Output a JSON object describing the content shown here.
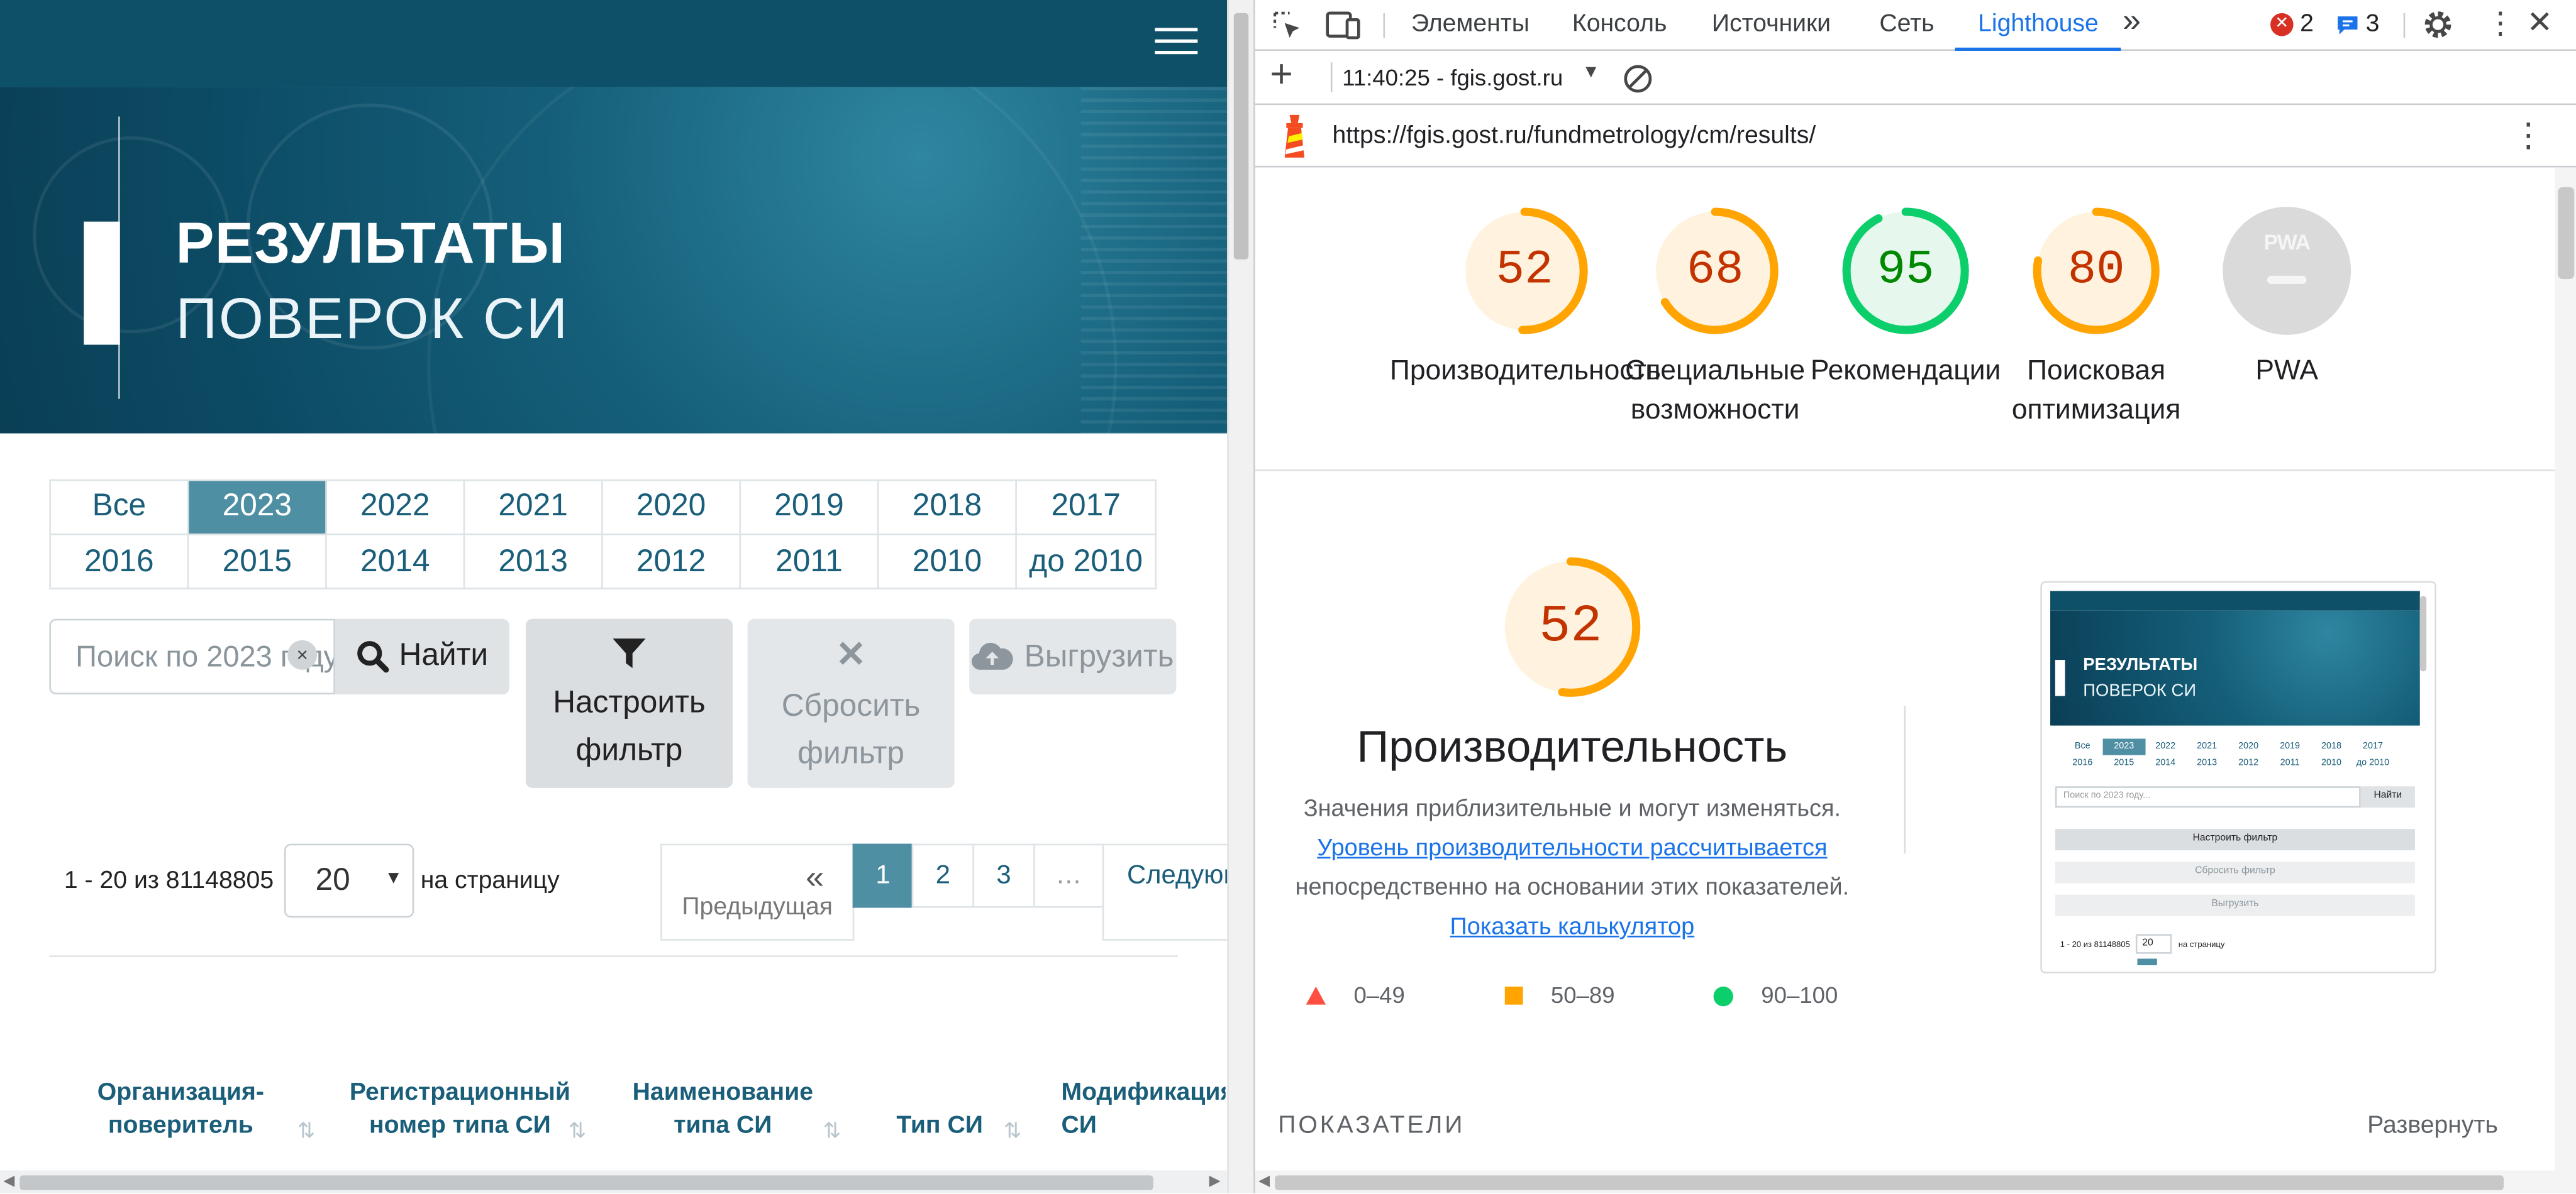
{
  "page": {
    "hero_title_line1": "РЕЗУЛЬТАТЫ",
    "hero_title_line2": "ПОВЕРОК СИ",
    "years_row1": [
      "Все",
      "2023",
      "2022",
      "2021",
      "2020",
      "2019",
      "2018",
      "2017"
    ],
    "years_row2": [
      "2016",
      "2015",
      "2014",
      "2013",
      "2012",
      "2011",
      "2010",
      "до 2010"
    ],
    "active_year": "2023",
    "search_placeholder": "Поиск по 2023 году...",
    "search_clear": "×",
    "find_label": "Найти",
    "filter_label": "Настроить фильтр",
    "reset_label": "Сбросить фильтр",
    "export_label": "Выгрузить",
    "range_text": "1 - 20 из 81148805",
    "per_page_value": "20",
    "per_page_label": "на страницу",
    "pager": {
      "prev": "Предыдущая",
      "p1": "1",
      "p2": "2",
      "p3": "3",
      "dots": "…",
      "next": "Следующая"
    },
    "columns": [
      "Организация-поверитель",
      "Регистрационный номер типа СИ",
      "Наименование типа СИ",
      "Тип СИ",
      "Модификация СИ"
    ]
  },
  "devtools": {
    "tabs": [
      "Элементы",
      "Консоль",
      "Источники",
      "Сеть",
      "Lighthouse"
    ],
    "active_tab": "Lighthouse",
    "more_tabs": "»",
    "error_count": "2",
    "message_count": "3",
    "report_time": "11:40:25 - fgis.gost.ru",
    "url": "https://fgis.gost.ru/fundmetrology/cm/results/",
    "scores": [
      {
        "label": "Производительность",
        "value": 52,
        "color": "#ffa400"
      },
      {
        "label": "Специальные возможности",
        "value": 68,
        "color": "#ffa400"
      },
      {
        "label": "Рекомендации",
        "value": 95,
        "color": "#0cce6b"
      },
      {
        "label": "Поисковая оптимизация",
        "value": 80,
        "color": "#ffa400"
      },
      {
        "label": "PWA",
        "value": null,
        "color": "#dadada"
      }
    ],
    "pwa_badge": "PWA",
    "main_score": 52,
    "main_title": "Производительность",
    "desc_text1": "Значения приблизительные и могут изменяться.",
    "desc_link1": "Уровень производительности рассчитывается",
    "desc_text2": "непосредственно на основании этих показателей.",
    "desc_link2": "Показать калькулятор",
    "legend": [
      {
        "range": "0–49",
        "color": "#ff4e42"
      },
      {
        "range": "50–89",
        "color": "#ffa400"
      },
      {
        "range": "90–100",
        "color": "#0cce6b"
      }
    ],
    "thumbnail": {
      "title1": "РЕЗУЛЬТАТЫ",
      "title2": "ПОВЕРОК СИ",
      "search": "Поиск по 2023 году...",
      "find": "Найти",
      "filter": "Настроить фильтр",
      "reset": "Сбросить фильтр",
      "export": "Выгрузить",
      "range": "1 - 20 из 81148805",
      "per_page": "20",
      "per_label": "на страницу"
    },
    "metrics_label": "ПОКАЗАТЕЛИ",
    "expand_label": "Развернуть"
  }
}
